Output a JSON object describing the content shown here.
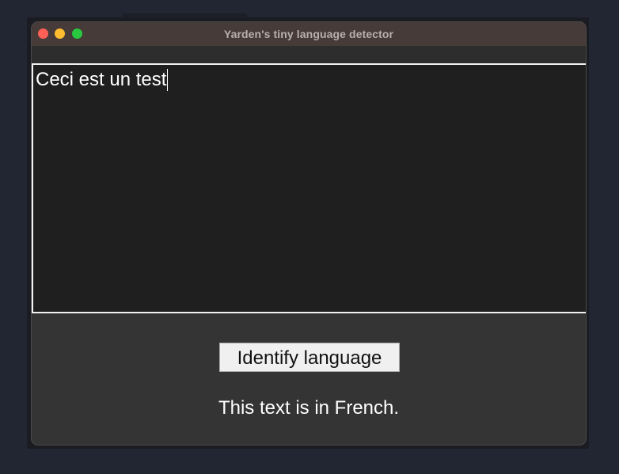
{
  "window": {
    "title": "Yarden's tiny language detector",
    "traffic_lights": {
      "close": "close-button",
      "minimize": "minimize-button",
      "zoom": "zoom-button"
    }
  },
  "input": {
    "value": "Ceci est un test"
  },
  "actions": {
    "identify_label": "Identify language"
  },
  "output": {
    "result_text": "This text is in French."
  },
  "colors": {
    "desktop": "#222632",
    "window_bg": "#343434",
    "titlebar": "#463b39",
    "textarea_bg": "#1f1f1f",
    "close": "#fe5f57",
    "minimize": "#febc2e",
    "zoom": "#28c840"
  }
}
